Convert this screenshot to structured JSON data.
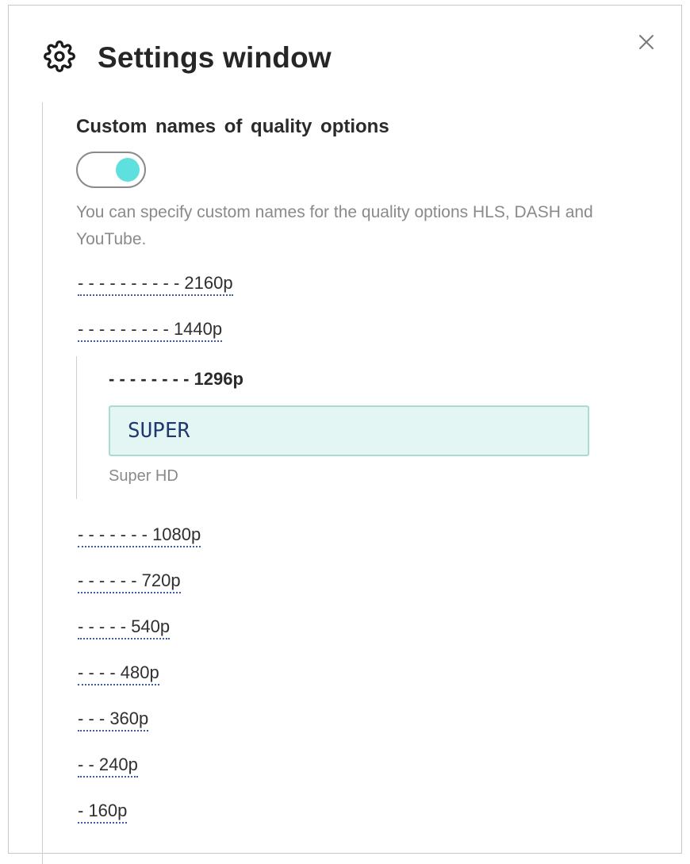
{
  "dialog": {
    "title": "Settings window",
    "icons": {
      "header": "gear-icon",
      "close": "close-icon"
    }
  },
  "section": {
    "heading": "Custom names of quality options",
    "toggle": {
      "on": true,
      "knob_color": "#5ee0df"
    },
    "description": "You can specify custom names for the quality options HLS, DASH and YouTube."
  },
  "qualities_top": [
    "- - - - - - - - - - 2160p",
    "- - - - - - - - - 1440p"
  ],
  "expanded": {
    "label": "- - - - - - - - 1296p",
    "input_value": "SUPER",
    "hint": "Super HD"
  },
  "qualities_bottom": [
    "- - - - - - - 1080p",
    "- - - - - - 720p",
    "- - - - - 540p",
    "- - - - 480p",
    "- - - 360p",
    "- - 240p",
    "- 160p"
  ],
  "colors": {
    "accent": "#5ee0df",
    "input_bg": "#e4f6f4",
    "input_border": "#a8dcd3",
    "link_underline": "#3d5aa8"
  }
}
